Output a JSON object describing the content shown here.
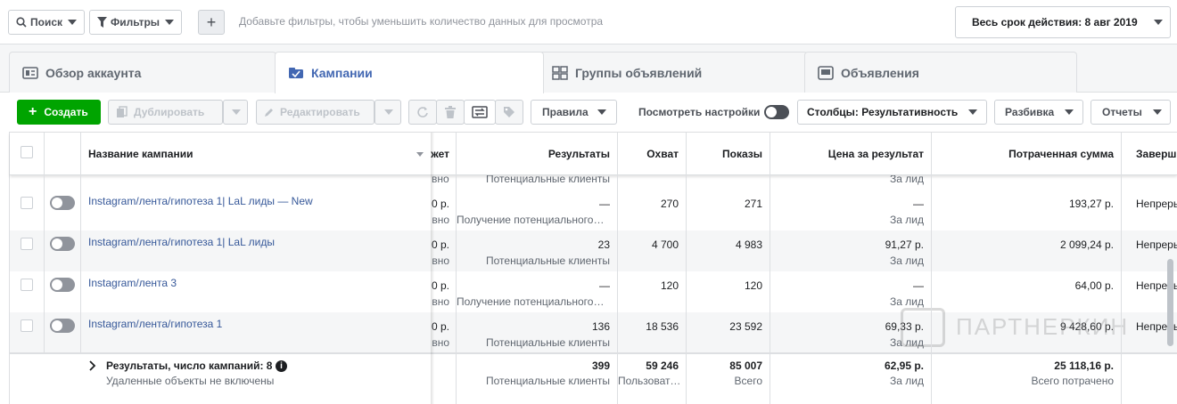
{
  "top": {
    "search_label": "Поиск",
    "filters_label": "Фильтры",
    "filter_hint": "Добавьте фильтры, чтобы уменьшить количество данных для просмотра",
    "date_range": "Весь срок действия: 8 авг 2019"
  },
  "tabs": [
    {
      "label": "Обзор аккаунта",
      "icon": "account-overview-icon"
    },
    {
      "label": "Кампании",
      "icon": "campaigns-icon"
    },
    {
      "label": "Группы объявлений",
      "icon": "ad-sets-icon"
    },
    {
      "label": "Объявления",
      "icon": "ads-icon"
    }
  ],
  "toolbar": {
    "create": "Создать",
    "duplicate": "Дублировать",
    "edit": "Редактировать",
    "rules": "Правила",
    "view_settings": "Посмотреть настройки",
    "columns": "Столбцы: Результативность",
    "breakdown": "Разбивка",
    "reports": "Отчеты"
  },
  "table": {
    "headers": {
      "name": "Название кампании",
      "budget": "жет",
      "results": "Результаты",
      "reach": "Охват",
      "impressions": "Показы",
      "cost": "Цена за результат",
      "spent": "Потраченная сумма",
      "ends": "Заверш"
    },
    "partial_row": {
      "budget": "вно",
      "results_sub": "Потенциальные клиенты",
      "cost_sub": "За лид"
    },
    "rows": [
      {
        "name": "Instagram/лента/гипотеза 1| LaL лиды — New",
        "budget": "0 р.",
        "budget_sub": "вно",
        "results": "—",
        "results_sub": "Получение потенциального клиента",
        "reach": "270",
        "impressions": "271",
        "cost": "—",
        "cost_sub": "За лид",
        "spent": "193,27 р.",
        "ends": "Непрерывно"
      },
      {
        "name": "Instagram/лента/гипотеза 1| LaL лиды",
        "budget": "0 р.",
        "budget_sub": "вно",
        "results": "23",
        "results_sub": "Потенциальные клиенты",
        "reach": "4 700",
        "impressions": "4 983",
        "cost": "91,27 р.",
        "cost_sub": "За лид",
        "spent": "2 099,24 р.",
        "ends": "Непрерывно"
      },
      {
        "name": "Instagram/лента 3",
        "budget": "0 р.",
        "budget_sub": "вно",
        "results": "—",
        "results_sub": "Получение потенциального клиента",
        "reach": "120",
        "impressions": "120",
        "cost": "—",
        "cost_sub": "За лид",
        "spent": "64,00 р.",
        "ends": "Непрерывно"
      },
      {
        "name": "Instagram/лента/гипотеза 1",
        "budget": "0 р.",
        "budget_sub": "вно",
        "results": "136",
        "results_sub": "Потенциальные клиенты",
        "reach": "18 536",
        "impressions": "23 592",
        "cost": "69,33 р.",
        "cost_sub": "За лид",
        "spent": "9 428,60 р.",
        "ends": "Непрерывно"
      }
    ],
    "summary": {
      "title": "Результаты, число кампаний: 8",
      "note": "Удаленные объекты не включены",
      "results": "399",
      "results_sub": "Потенциальные клиенты",
      "reach": "59 246",
      "reach_sub": "Пользователи",
      "impressions": "85 007",
      "impressions_sub": "Всего",
      "cost": "62,95 р.",
      "cost_sub": "За лид",
      "spent": "25 118,16 р.",
      "spent_sub": "Всего потрачено"
    }
  },
  "watermark": "ПАРТНЕРКИН",
  "colors": {
    "accent": "#4267b2",
    "create": "#00a400",
    "link": "#365899"
  }
}
